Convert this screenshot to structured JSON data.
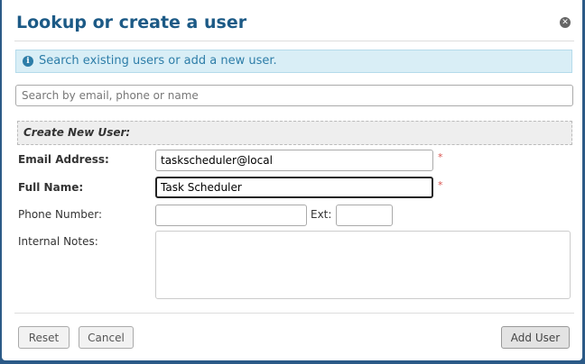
{
  "dialog": {
    "title": "Lookup or create a user",
    "close_icon": "close-icon",
    "info_icon": "info-icon",
    "info_text": "Search existing users or add a new user.",
    "search_placeholder": "Search by email, phone or name"
  },
  "form": {
    "section_title": "Create New User:",
    "email_label": "Email Address:",
    "email_value": "taskscheduler@local",
    "fullname_label": "Full Name:",
    "fullname_value": "Task Scheduler",
    "phone_label": "Phone Number:",
    "phone_value": "",
    "ext_label": "Ext:",
    "ext_value": "",
    "notes_label": "Internal Notes:",
    "notes_value": "",
    "required_marker": "*"
  },
  "buttons": {
    "reset": "Reset",
    "cancel": "Cancel",
    "add_user": "Add User"
  },
  "colors": {
    "title": "#1c5a86",
    "info_background": "#d9eef6",
    "info_text": "#2d7da8",
    "required": "#d9534f",
    "backdrop": "#2b5a87"
  }
}
